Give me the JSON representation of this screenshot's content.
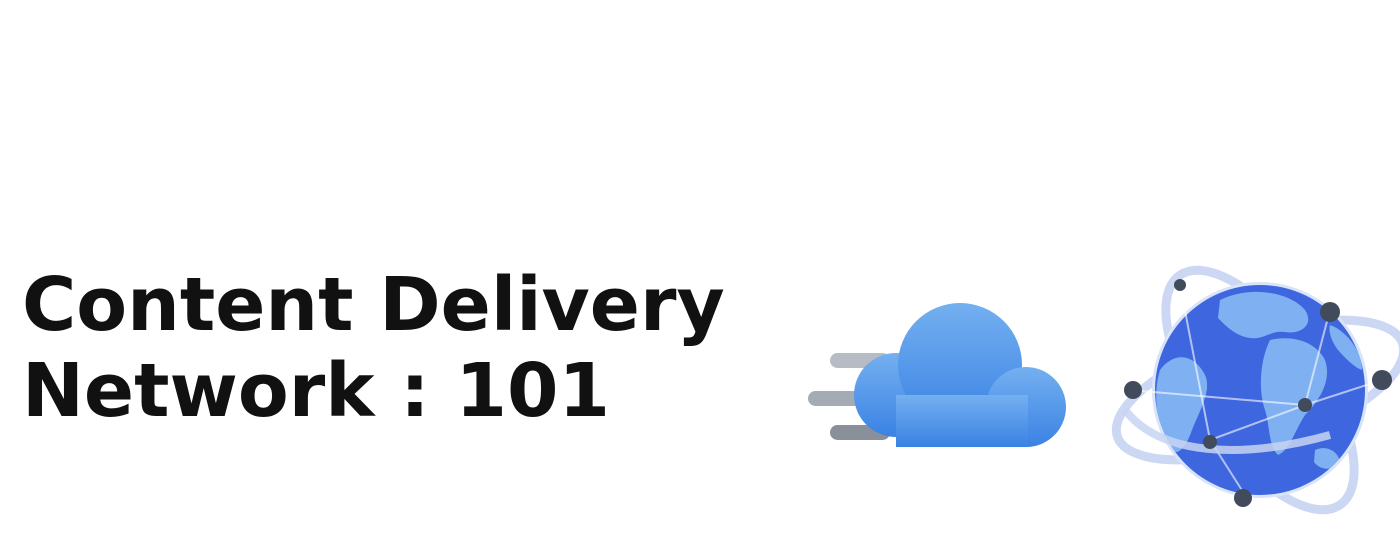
{
  "headline": {
    "line1": "Content Delivery",
    "line2": "Network : 101"
  },
  "colors": {
    "text": "#111111",
    "cloud_light": "#6aa9ee",
    "cloud_dark": "#3d86e6",
    "globe_ocean": "#3f6be2",
    "globe_land": "#7fb2f3",
    "orbit": "#c4d2f2",
    "node": "#3f4a5c",
    "speed_lines": "#8e95a1"
  },
  "icons": {
    "cloud": "cloud-icon",
    "globe": "globe-icon"
  }
}
